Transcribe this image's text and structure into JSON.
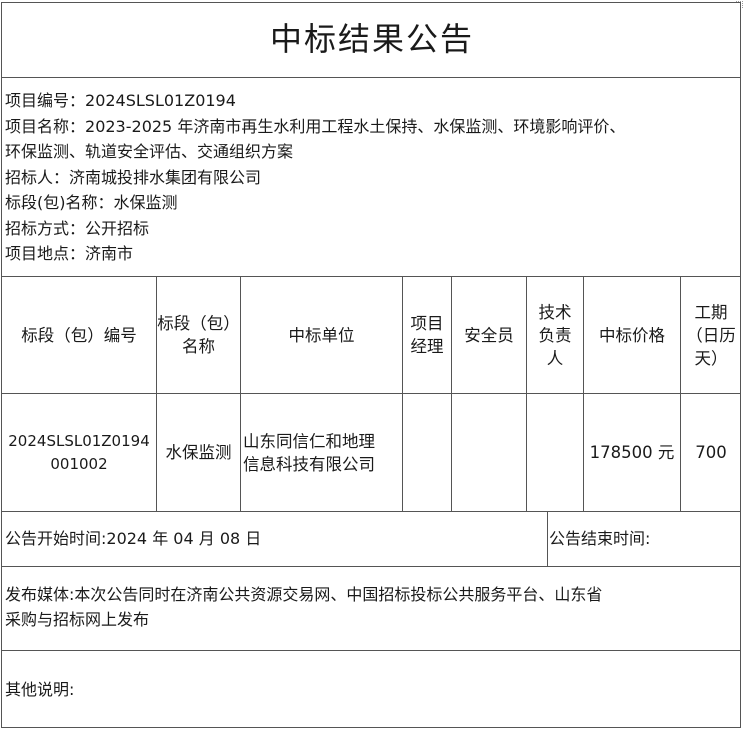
{
  "document": {
    "title": "中标结果公告",
    "info": [
      {
        "label": "项目编号：",
        "value": "2024SLSL01Z0194"
      },
      {
        "label": "项目名称：",
        "value": "2023-2025 年济南市再生水利用工程水土保持、水保监测、环境影响评价、"
      },
      {
        "label": "",
        "value": "环保监测、轨道安全评估、交通组织方案"
      },
      {
        "label": "招标人：",
        "value": "济南城投排水集团有限公司"
      },
      {
        "label": "标段(包)名称：",
        "value": "水保监测"
      },
      {
        "label": "招标方式：",
        "value": "公开招标"
      },
      {
        "label": "项目地点：",
        "value": "济南市"
      }
    ],
    "table": {
      "headers": [
        [
          "标段（包）编号"
        ],
        [
          "标段（包）",
          "名称"
        ],
        [
          "中标单位"
        ],
        [
          "项目",
          "经理"
        ],
        [
          "安全员"
        ],
        [
          "技术",
          "负责",
          "人"
        ],
        [
          "中标价格"
        ],
        [
          "工期",
          "（日历",
          "天）"
        ]
      ],
      "rows": [
        {
          "code": [
            "2024SLSL01Z0194",
            "001002"
          ],
          "name": "水保监测",
          "winner": [
            "山东同信仁和地理",
            "信息科技有限公司"
          ],
          "manager": "",
          "safety": "",
          "tech": "",
          "price": "178500 元",
          "duration": "700"
        }
      ]
    },
    "start_time": "公告开始时间:2024 年 04 月 08 日",
    "end_time": "公告结束时间:",
    "media": [
      "发布媒体:本次公告同时在济南公共资源交易网、中国招标投标公共服务平台、山东省",
      "采购与招标网上发布"
    ],
    "other": "其他说明:"
  }
}
